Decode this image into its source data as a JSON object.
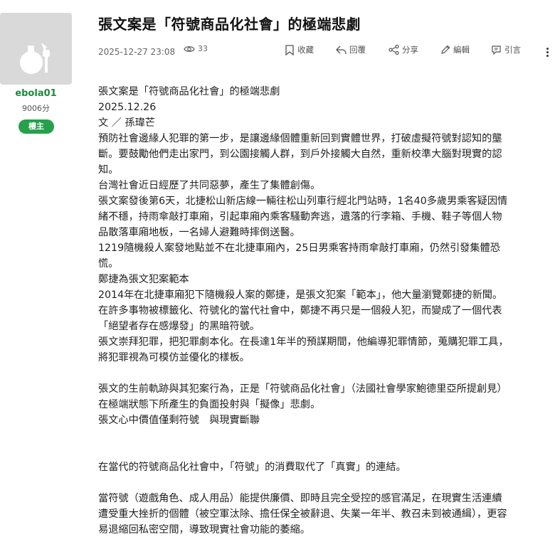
{
  "user": {
    "username": "ebola01",
    "score": "9006分",
    "badge": "樓主"
  },
  "post": {
    "title": "張文案是「符號商品化社會」的極端悲劇",
    "date": "2025-12-27 23:08",
    "views": "33"
  },
  "actions": {
    "favorite": "收藏",
    "reply": "回覆",
    "share": "分享",
    "edit": "編輯",
    "quote": "引言"
  },
  "icons": [
    "eye-icon",
    "bookmark-icon",
    "reply-icon",
    "share-icon",
    "pencil-icon",
    "quote-icon",
    "more-vertical-icon"
  ],
  "article": {
    "lines": [
      "張文案是「符號商品化社會」的極端悲劇",
      "2025.12.26",
      "文 ／ 孫瑋芒",
      "預防社會邊緣人犯罪的第一步，是讓邊緣個體重新回到實體世界，打破虛擬符號對認知的壟",
      "斷。要鼓勵他們走出家門，到公園接觸人群，到戶外接觸大自然，重新校準大腦對現實的認",
      "知。",
      "台灣社會近日經歷了共同惡夢，產生了集體創傷。",
      "張文案發後第6天，北捷松山新店線一輛往松山列車行經北門站時，1名40多歲男乘客疑因情",
      "緒不穩，持雨傘敲打車廂，引起車廂內乘客騷動奔逃，遺落的行李箱、手機、鞋子等個人物",
      "品散落車廂地板，一名婦人避難時摔倒送醫。",
      "1219隨機殺人案發地點並不在北捷車廂內，25日男乘客持雨傘敲打車廂，仍然引發集體恐",
      "慌。",
      "鄭捷為張文犯案範本",
      "2014年在北捷車廂犯下隨機殺人案的鄭捷，是張文犯案「範本」，他大量瀏覽鄭捷的新聞。",
      "在許多事物被標籤化、符號化的當代社會中，鄭捷不再只是一個殺人犯，而變成了一個代表",
      "「絕望者存在感爆發」的黑暗符號。",
      "張文崇拜犯罪，把犯罪劇本化。在長達1年半的預謀期間，他編導犯罪情節，蒐購犯罪工具，",
      "將犯罪視為可模仿並優化的樣板。",
      "",
      "張文的生前軌跡與其犯案行為，正是「符號商品化社會」（法國社會學家鮑德里亞所提創見）",
      "在極端狀態下所產生的負面投射與「擬像」悲劇。",
      "張文心中價值僅剩符號　與現實斷聯",
      "",
      "",
      "在當代的符號商品化社會中，「符號」的消費取代了「真實」的連結。",
      "",
      "當符號（遊戲角色、成人用品）能提供廉價、即時且完全受控的感官滿足，在現實生活連續",
      "遭受重大挫折的個體（被空軍汰除、擔任保全被辭退、失業一年半、教召未到被通緝），更容",
      "易退縮回私密空間，導致現實社會功能的萎縮。"
    ]
  },
  "colors": {
    "accent_green": "#1b8a3c",
    "badge_green": "#26a04a",
    "avatar_bg": "#d9d9d9"
  }
}
